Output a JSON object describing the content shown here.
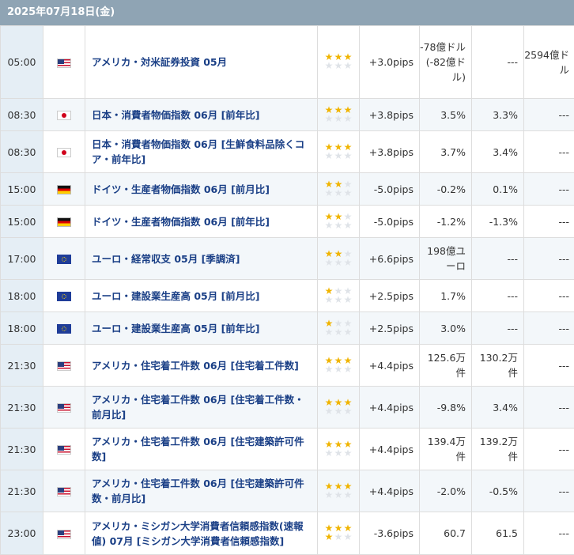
{
  "header": {
    "date": "2025年07月18日(金)"
  },
  "colors": {
    "header_bg": "#8fa4b4",
    "event_text": "#1a3f86",
    "star_on": "#f0b400",
    "star_off": "#dfe3e8"
  },
  "rows": [
    {
      "time": "05:00",
      "country": "us",
      "flag_icon": "us-flag-icon",
      "event": "アメリカ・対米証券投資 05月",
      "stars": 3,
      "pips": "+3.0pips",
      "v1": "-78億ドル(-82億ドル)",
      "v2": "---",
      "v3": "2594億ドル"
    },
    {
      "time": "08:30",
      "country": "jp",
      "flag_icon": "japan-flag-icon",
      "event": "日本・消費者物価指数 06月 [前年比]",
      "stars": 3,
      "pips": "+3.8pips",
      "v1": "3.5%",
      "v2": "3.3%",
      "v3": "---"
    },
    {
      "time": "08:30",
      "country": "jp",
      "flag_icon": "japan-flag-icon",
      "event": "日本・消費者物価指数 06月 [生鮮食料品除くコア・前年比]",
      "stars": 3,
      "pips": "+3.8pips",
      "v1": "3.7%",
      "v2": "3.4%",
      "v3": "---"
    },
    {
      "time": "15:00",
      "country": "de",
      "flag_icon": "germany-flag-icon",
      "event": "ドイツ・生産者物価指数 06月 [前月比]",
      "stars": 2,
      "pips": "-5.0pips",
      "v1": "-0.2%",
      "v2": "0.1%",
      "v3": "---"
    },
    {
      "time": "15:00",
      "country": "de",
      "flag_icon": "germany-flag-icon",
      "event": "ドイツ・生産者物価指数 06月 [前年比]",
      "stars": 2,
      "pips": "-5.0pips",
      "v1": "-1.2%",
      "v2": "-1.3%",
      "v3": "---"
    },
    {
      "time": "17:00",
      "country": "eu",
      "flag_icon": "eu-flag-icon",
      "event": "ユーロ・経常収支 05月 [季調済]",
      "stars": 2,
      "pips": "+6.6pips",
      "v1": "198億ユーロ",
      "v2": "---",
      "v3": "---"
    },
    {
      "time": "18:00",
      "country": "eu",
      "flag_icon": "eu-flag-icon",
      "event": "ユーロ・建設業生産高 05月 [前月比]",
      "stars": 1,
      "pips": "+2.5pips",
      "v1": "1.7%",
      "v2": "---",
      "v3": "---"
    },
    {
      "time": "18:00",
      "country": "eu",
      "flag_icon": "eu-flag-icon",
      "event": "ユーロ・建設業生産高 05月 [前年比]",
      "stars": 1,
      "pips": "+2.5pips",
      "v1": "3.0%",
      "v2": "---",
      "v3": "---"
    },
    {
      "time": "21:30",
      "country": "us",
      "flag_icon": "us-flag-icon",
      "event": "アメリカ・住宅着工件数 06月 [住宅着工件数]",
      "stars": 3,
      "pips": "+4.4pips",
      "v1": "125.6万件",
      "v2": "130.2万件",
      "v3": "---"
    },
    {
      "time": "21:30",
      "country": "us",
      "flag_icon": "us-flag-icon",
      "event": "アメリカ・住宅着工件数 06月 [住宅着工件数・前月比]",
      "stars": 3,
      "pips": "+4.4pips",
      "v1": "-9.8%",
      "v2": "3.4%",
      "v3": "---"
    },
    {
      "time": "21:30",
      "country": "us",
      "flag_icon": "us-flag-icon",
      "event": "アメリカ・住宅着工件数 06月 [住宅建築許可件数]",
      "stars": 3,
      "pips": "+4.4pips",
      "v1": "139.4万件",
      "v2": "139.2万件",
      "v3": "---"
    },
    {
      "time": "21:30",
      "country": "us",
      "flag_icon": "us-flag-icon",
      "event": "アメリカ・住宅着工件数 06月 [住宅建築許可件数・前月比]",
      "stars": 3,
      "pips": "+4.4pips",
      "v1": "-2.0%",
      "v2": "-0.5%",
      "v3": "---"
    },
    {
      "time": "23:00",
      "country": "us",
      "flag_icon": "us-flag-icon",
      "event": "アメリカ・ミシガン大学消費者信頼感指数(速報値) 07月 [ミシガン大学消費者信頼感指数]",
      "stars": 4,
      "pips": "-3.6pips",
      "v1": "60.7",
      "v2": "61.5",
      "v3": "---"
    }
  ]
}
